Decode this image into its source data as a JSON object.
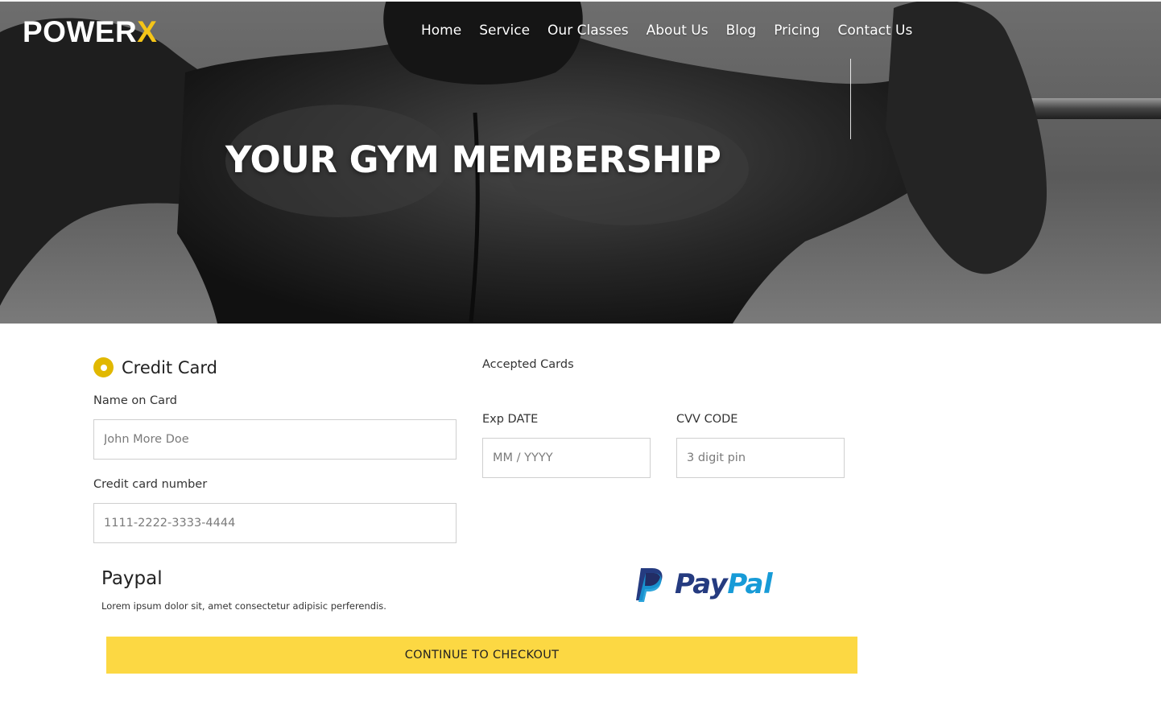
{
  "header": {
    "logo_main": "POWER",
    "logo_accent": "X",
    "nav": [
      {
        "label": "Home"
      },
      {
        "label": "Service"
      },
      {
        "label": "Our Classes"
      },
      {
        "label": "About Us"
      },
      {
        "label": "Blog"
      },
      {
        "label": "Pricing"
      },
      {
        "label": "Contact Us"
      }
    ]
  },
  "hero": {
    "title": "YOUR GYM MEMBERSHIP"
  },
  "payment": {
    "credit_card_option": "Credit Card",
    "accepted_cards_label": "Accepted Cards",
    "name_label": "Name on Card",
    "name_placeholder": "John More Doe",
    "card_number_label": "Credit card number",
    "card_number_placeholder": "1111-2222-3333-4444",
    "exp_label": "Exp DATE",
    "exp_placeholder": "MM / YYYY",
    "cvv_label": "CVV CODE",
    "cvv_placeholder": "3 digit pin",
    "paypal_title": "Paypal",
    "paypal_description": "Lorem ipsum dolor sit, amet consectetur adipisic perferendis.",
    "paypal_logo_pay": "Pay",
    "paypal_logo_pal": "Pal",
    "checkout_label": "CONTINUE TO CHECKOUT"
  },
  "colors": {
    "accent_yellow": "#fcd843",
    "radio_yellow": "#e1b800",
    "logo_accent": "#f5c518",
    "paypal_dark_blue": "#253b80",
    "paypal_light_blue": "#179bd7"
  },
  "icons": {
    "radio": "radio-selected-icon",
    "paypal": "paypal-logo-icon"
  }
}
